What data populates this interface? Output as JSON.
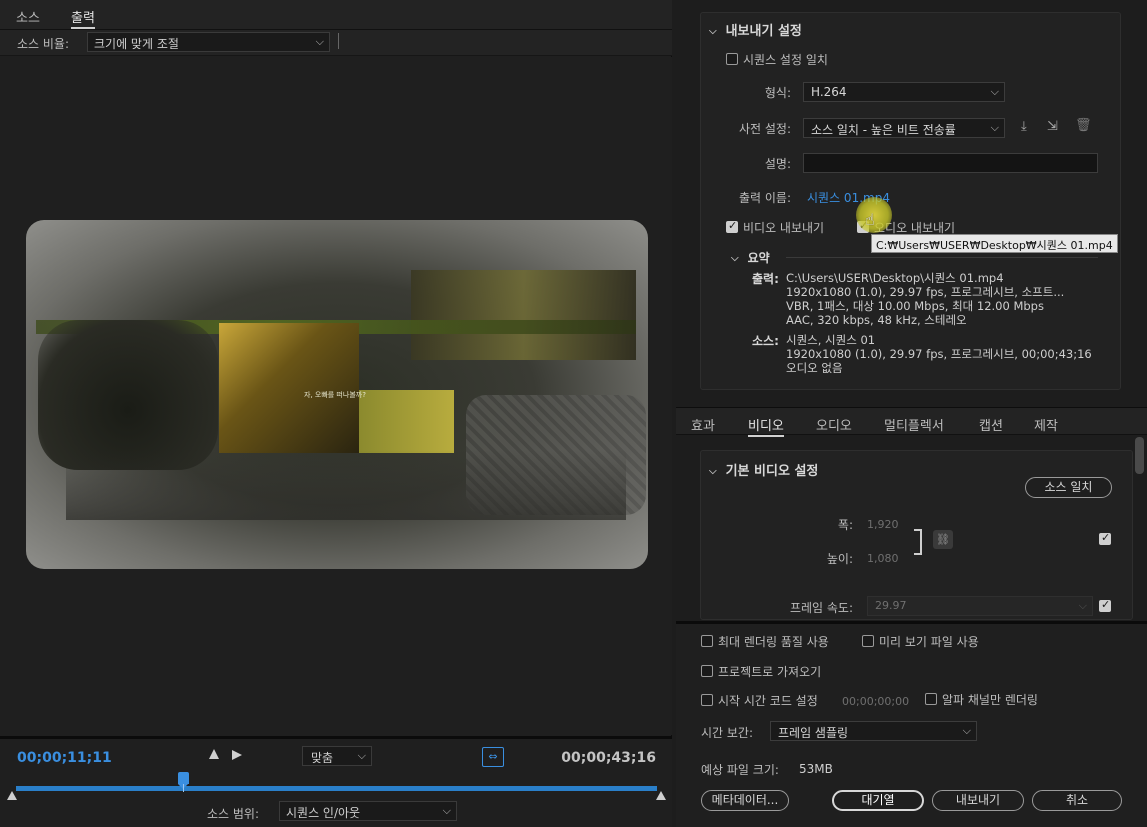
{
  "left": {
    "tabs": [
      {
        "label": "소스"
      },
      {
        "label": "출력"
      }
    ],
    "active_tab": 1,
    "source_scale_label": "소스 비율:",
    "source_scale_value": "크기에 맞게 조절",
    "subtitle": "자, 오빠를 떠나볼까?",
    "timecode_in": "00;00;11;11",
    "timecode_out": "00;00;43;16",
    "fit_value": "맞춤",
    "range_label": "소스 범위:",
    "range_value": "시퀀스 인/아웃",
    "playhead_fraction": 0.26
  },
  "right": {
    "export_settings": {
      "title": "내보내기 설정",
      "match_sequence_label": "시퀀스 설정 일치",
      "match_sequence_checked": false,
      "format_label": "형식:",
      "format_value": "H.264",
      "preset_label": "사전 설정:",
      "preset_value": "소스 일치 - 높은 비트 전송률",
      "comment_label": "설명:",
      "comment_value": "",
      "output_name_label": "출력 이름:",
      "output_name_value": "시퀀스 01.mp4",
      "tooltip": "C:₩Users₩USER₩Desktop₩시퀀스 01.mp4",
      "export_video_label": "비디오 내보내기",
      "export_video_checked": true,
      "export_audio_label": "오디오 내보내기",
      "summary_title": "요약",
      "summary_output_key": "출력:",
      "summary_output_lines": [
        "C:\\Users\\USER\\Desktop\\시퀀스 01.mp4",
        "1920x1080 (1.0), 29.97 fps, 프로그레시브, 소프트...",
        "VBR, 1패스, 대상 10.00 Mbps, 최대 12.00 Mbps",
        "AAC, 320 kbps, 48 kHz, 스테레오"
      ],
      "summary_source_key": "소스:",
      "summary_source_lines": [
        "시퀀스, 시퀀스 01",
        "1920x1080 (1.0), 29.97 fps, 프로그레시브, 00;00;43;16",
        "오디오 없음"
      ]
    },
    "tabs": [
      {
        "label": "효과"
      },
      {
        "label": "비디오"
      },
      {
        "label": "오디오"
      },
      {
        "label": "멀티플렉서"
      },
      {
        "label": "캡션"
      },
      {
        "label": "제작"
      }
    ],
    "active_tab": 1,
    "video_settings": {
      "title": "기본 비디오 설정",
      "match_source_button": "소스 일치",
      "width_label": "폭:",
      "width_value": "1,920",
      "height_label": "높이:",
      "height_value": "1,080",
      "frame_rate_label": "프레임 속도:",
      "frame_rate_value": "29.97"
    },
    "bottom": {
      "max_render_label": "최대 렌더링 품질 사용",
      "use_preview_label": "미리 보기 파일 사용",
      "import_project_label": "프로젝트로 가져오기",
      "start_tc_label": "시작 시간 코드 설정",
      "start_tc_value": "00;00;00;00",
      "alpha_only_label": "알파 채널만 렌더링",
      "time_interp_label": "시간 보간:",
      "time_interp_value": "프레임 샘플링",
      "est_size_label": "예상 파일 크기:",
      "est_size_value": "53MB",
      "metadata_button": "메타데이터...",
      "queue_button": "대기열",
      "export_button": "내보내기",
      "cancel_button": "취소"
    }
  },
  "colors": {
    "accent_blue": "#3a8fe0",
    "cursor_highlight": "#d4d23c"
  }
}
